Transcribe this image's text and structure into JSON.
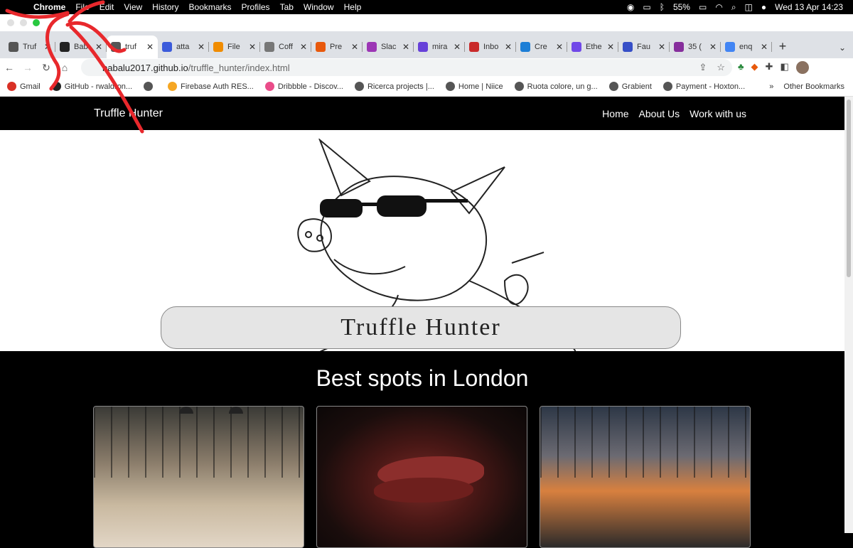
{
  "menubar": {
    "app": "Chrome",
    "items": [
      "File",
      "Edit",
      "View",
      "History",
      "Bookmarks",
      "Profiles",
      "Tab",
      "Window",
      "Help"
    ],
    "battery": "55%",
    "datetime": "Wed 13 Apr  14:23"
  },
  "tabs": [
    {
      "label": "Truf",
      "color": "#555"
    },
    {
      "label": "Bab",
      "color": "#222"
    },
    {
      "label": "truf",
      "color": "#555",
      "active": true
    },
    {
      "label": "atta",
      "color": "#3b5bdb"
    },
    {
      "label": "File",
      "color": "#f08c00"
    },
    {
      "label": "Coff",
      "color": "#777"
    },
    {
      "label": "Pre",
      "color": "#e8590c"
    },
    {
      "label": "Slac",
      "color": "#9c36b5"
    },
    {
      "label": "mira",
      "color": "#6741d9"
    },
    {
      "label": "Inbo",
      "color": "#c92a2a"
    },
    {
      "label": "Cre",
      "color": "#1c7ed6"
    },
    {
      "label": "Ethe",
      "color": "#7048e8"
    },
    {
      "label": "Fau",
      "color": "#364fc7"
    },
    {
      "label": "35 (",
      "color": "#862e9c"
    },
    {
      "label": "enq",
      "color": "#4285f4"
    }
  ],
  "address": {
    "host": "babalu2017.github.io",
    "path": "/truffle_hunter/index.html"
  },
  "bookmarks": [
    {
      "label": "Gmail",
      "color": "#d93025"
    },
    {
      "label": "GitHub - rwaldron...",
      "color": "#222"
    },
    {
      "label": "",
      "color": "#555"
    },
    {
      "label": "Firebase Auth RES...",
      "color": "#f5a623"
    },
    {
      "label": "Dribbble - Discov...",
      "color": "#ea4c89"
    },
    {
      "label": "Ricerca projects |...",
      "color": "#555"
    },
    {
      "label": "Home | Niice",
      "color": "#555"
    },
    {
      "label": "Ruota colore, un g...",
      "color": "#555"
    },
    {
      "label": "Grabient",
      "color": "#555"
    },
    {
      "label": "Payment - Hoxton...",
      "color": "#555"
    }
  ],
  "other_bookmarks": "Other Bookmarks",
  "site": {
    "brand": "Truffle Hunter",
    "nav": [
      "Home",
      "About Us",
      "Work with us"
    ],
    "banner_text": "Truffle Hunter",
    "section_title": "Best spots in London"
  },
  "icons": {
    "apple": "apple-icon",
    "new_tab": "plus-icon"
  },
  "colors": {
    "traffic_close": "#e0e0e0",
    "traffic_min": "#e0e0e0",
    "traffic_max": "#28c840",
    "annotation": "#e8282c"
  }
}
